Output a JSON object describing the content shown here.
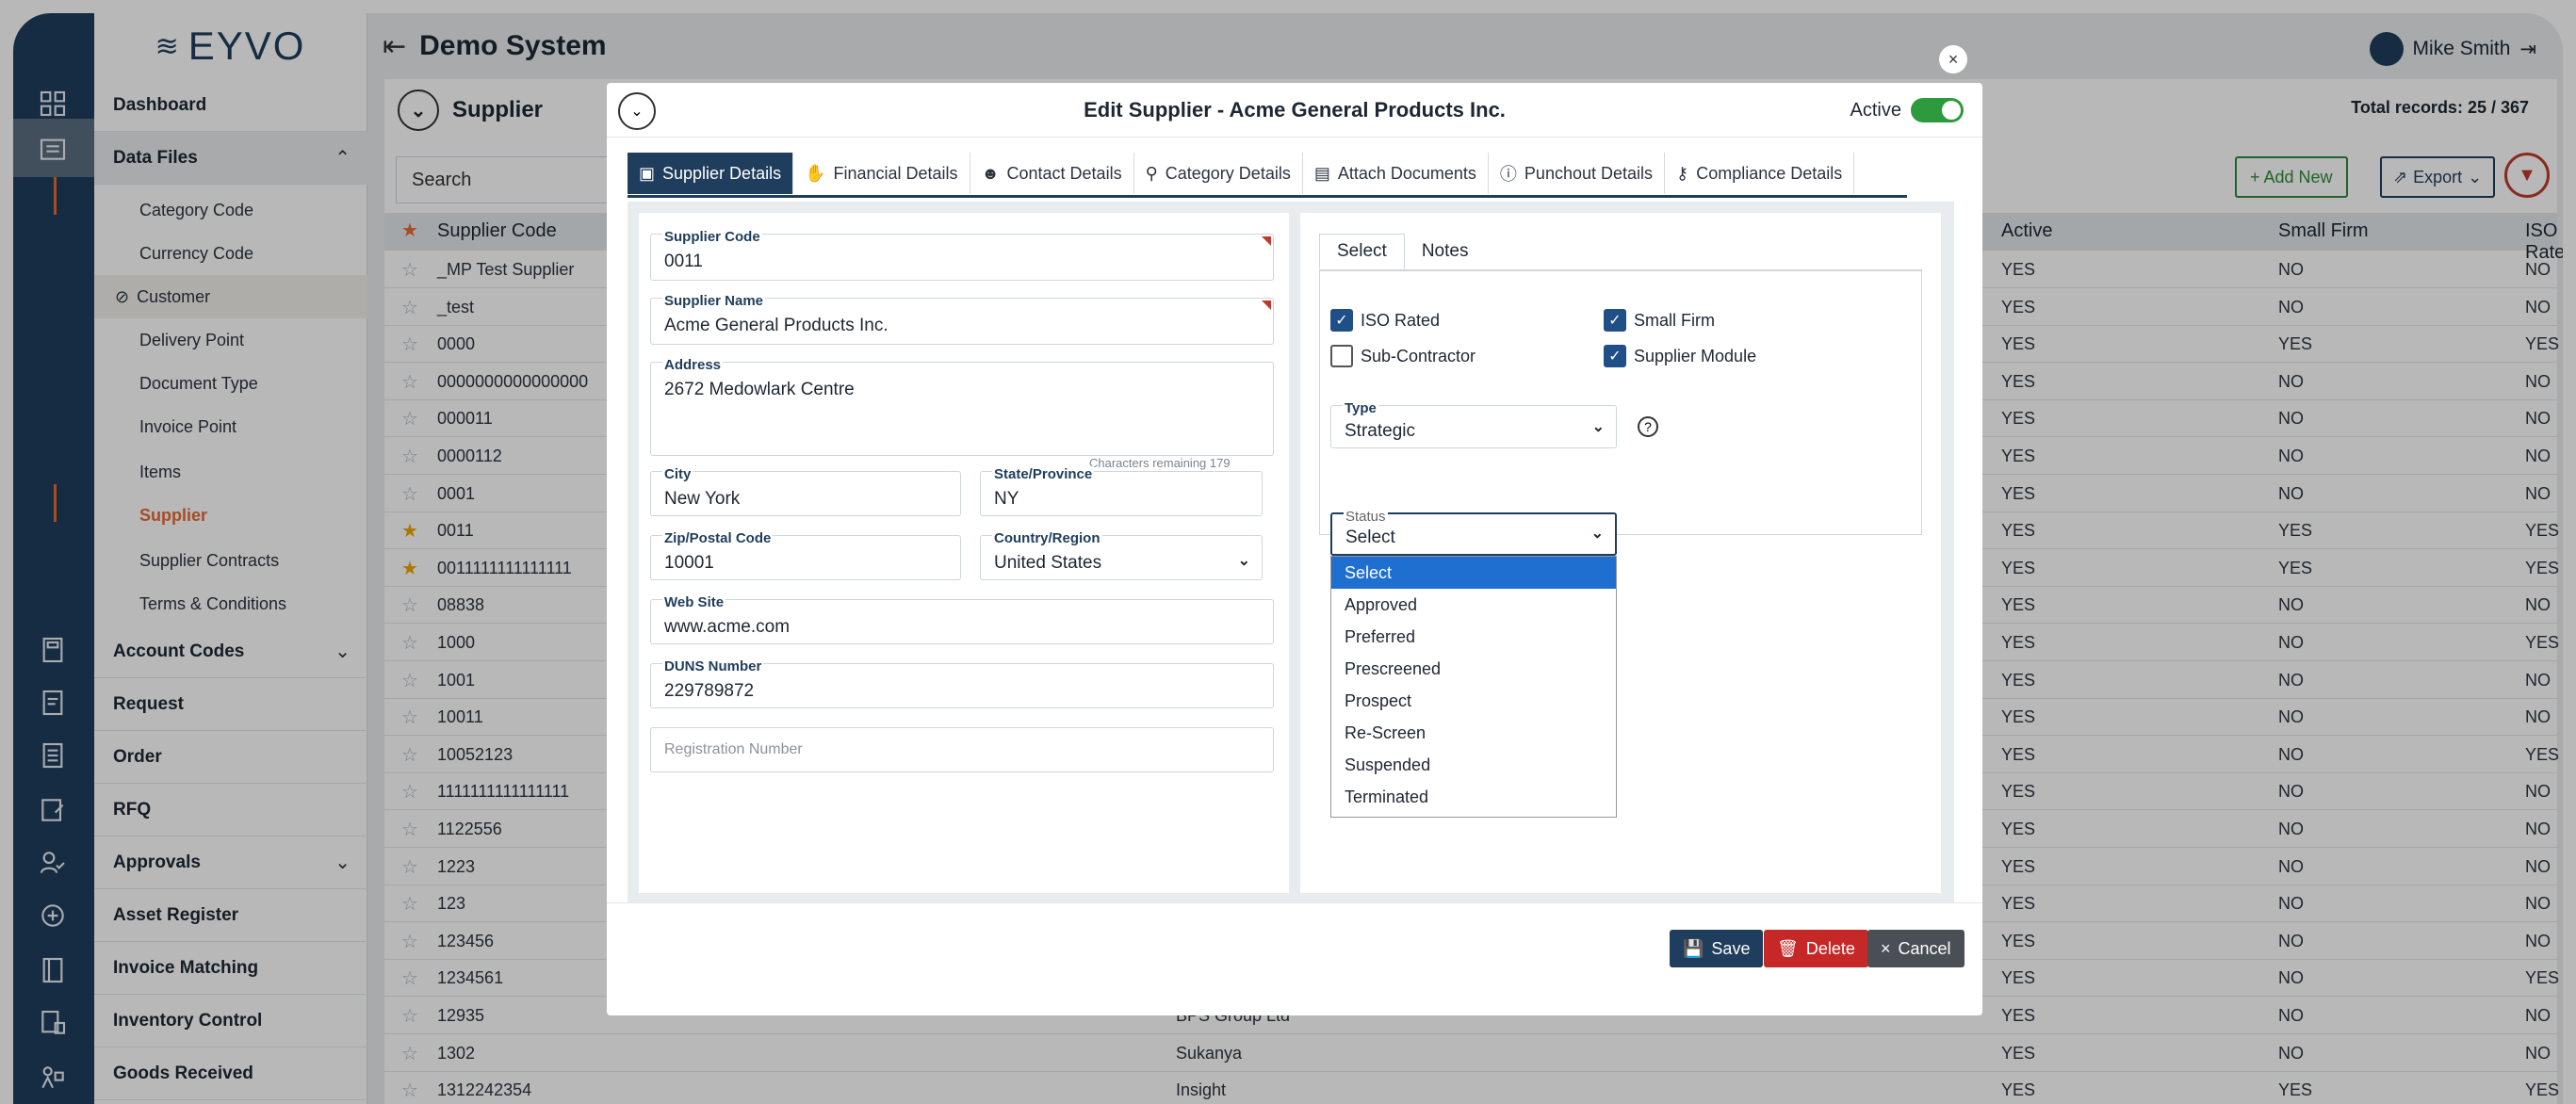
{
  "app": {
    "logo_text": "EYVO",
    "title": "Demo System",
    "user_name": "Mike Smith"
  },
  "sidebar": {
    "items": [
      {
        "label": "Dashboard"
      },
      {
        "label": "Data Files"
      },
      {
        "label": "Account Codes"
      },
      {
        "label": "Request"
      },
      {
        "label": "Order"
      },
      {
        "label": "RFQ"
      },
      {
        "label": "Approvals"
      },
      {
        "label": "Asset Register"
      },
      {
        "label": "Invoice Matching"
      },
      {
        "label": "Inventory Control"
      },
      {
        "label": "Goods Received"
      }
    ],
    "subitems": [
      {
        "label": "Category Code"
      },
      {
        "label": "Currency Code"
      },
      {
        "label": "Customer"
      },
      {
        "label": "Delivery Point"
      },
      {
        "label": "Document Type"
      },
      {
        "label": "Invoice Point"
      },
      {
        "label": "Items"
      },
      {
        "label": "Supplier"
      },
      {
        "label": "Supplier Contracts"
      },
      {
        "label": "Terms & Conditions"
      }
    ]
  },
  "list": {
    "title": "Supplier",
    "total_records": "Total records: 25 / 367",
    "search_placeholder": "Search",
    "add_new": "+ Add New",
    "export": "Export",
    "columns": {
      "code": "Supplier Code",
      "active": "Active",
      "small": "Small Firm",
      "iso": "ISO Rated"
    },
    "rows": [
      {
        "code": "_MP Test Supplier",
        "name": "",
        "active": "YES",
        "small": "NO",
        "iso": "NO",
        "star": false
      },
      {
        "code": "_test",
        "name": "",
        "active": "YES",
        "small": "NO",
        "iso": "NO",
        "star": false
      },
      {
        "code": "0000",
        "name": "",
        "active": "YES",
        "small": "YES",
        "iso": "YES",
        "star": false
      },
      {
        "code": "0000000000000000",
        "name": "",
        "active": "YES",
        "small": "NO",
        "iso": "NO",
        "star": false
      },
      {
        "code": "000011",
        "name": "",
        "active": "YES",
        "small": "NO",
        "iso": "NO",
        "star": false
      },
      {
        "code": "0000112",
        "name": "",
        "active": "YES",
        "small": "NO",
        "iso": "NO",
        "star": false
      },
      {
        "code": "0001",
        "name": "",
        "active": "YES",
        "small": "NO",
        "iso": "NO",
        "star": false
      },
      {
        "code": "0011",
        "name": "",
        "active": "YES",
        "small": "YES",
        "iso": "YES",
        "star": true
      },
      {
        "code": "0011111111111111",
        "name": "",
        "active": "YES",
        "small": "YES",
        "iso": "YES",
        "star": true
      },
      {
        "code": "08838",
        "name": "",
        "active": "YES",
        "small": "NO",
        "iso": "NO",
        "star": false
      },
      {
        "code": "1000",
        "name": "",
        "active": "YES",
        "small": "NO",
        "iso": "YES",
        "star": false
      },
      {
        "code": "1001",
        "name": "",
        "active": "YES",
        "small": "NO",
        "iso": "NO",
        "star": false
      },
      {
        "code": "10011",
        "name": "",
        "active": "YES",
        "small": "NO",
        "iso": "NO",
        "star": false
      },
      {
        "code": "10052123",
        "name": "",
        "active": "YES",
        "small": "NO",
        "iso": "YES",
        "star": false
      },
      {
        "code": "1111111111111111",
        "name": "",
        "active": "YES",
        "small": "NO",
        "iso": "NO",
        "star": false
      },
      {
        "code": "1122556",
        "name": "",
        "active": "YES",
        "small": "NO",
        "iso": "NO",
        "star": false
      },
      {
        "code": "1223",
        "name": "",
        "active": "YES",
        "small": "NO",
        "iso": "NO",
        "star": false
      },
      {
        "code": "123",
        "name": "",
        "active": "YES",
        "small": "NO",
        "iso": "NO",
        "star": false
      },
      {
        "code": "123456",
        "name": "",
        "active": "YES",
        "small": "NO",
        "iso": "NO",
        "star": false
      },
      {
        "code": "1234561",
        "name": "",
        "active": "YES",
        "small": "NO",
        "iso": "YES",
        "star": false
      },
      {
        "code": "12935",
        "name": "BPS Group Ltd",
        "active": "YES",
        "small": "NO",
        "iso": "NO",
        "star": false
      },
      {
        "code": "1302",
        "name": "Sukanya",
        "active": "YES",
        "small": "NO",
        "iso": "NO",
        "star": false
      },
      {
        "code": "1312242354",
        "name": "Insight",
        "active": "YES",
        "small": "YES",
        "iso": "YES",
        "star": false
      }
    ]
  },
  "modal": {
    "title": "Edit Supplier - Acme General Products Inc.",
    "active_label": "Active",
    "tabs": [
      {
        "label": "Supplier Details",
        "icon": "id-card-icon"
      },
      {
        "label": "Financial Details",
        "icon": "money-hand-icon"
      },
      {
        "label": "Contact Details",
        "icon": "people-icon"
      },
      {
        "label": "Category Details",
        "icon": "pin-icon"
      },
      {
        "label": "Attach Documents",
        "icon": "document-icon"
      },
      {
        "label": "Punchout Details",
        "icon": "info-icon"
      },
      {
        "label": "Compliance Details",
        "icon": "key-icon"
      }
    ],
    "fields": {
      "supplier_code": {
        "label": "Supplier Code",
        "value": "0011"
      },
      "supplier_name": {
        "label": "Supplier Name",
        "value": "Acme General Products Inc."
      },
      "address": {
        "label": "Address",
        "value": "2672 Medowlark Centre"
      },
      "chars_remaining": "Characters remaining 179",
      "city": {
        "label": "City",
        "value": "New York"
      },
      "state": {
        "label": "State/Province",
        "value": "NY"
      },
      "zip": {
        "label": "Zip/Postal Code",
        "value": "10001"
      },
      "country": {
        "label": "Country/Region",
        "value": "United States"
      },
      "website": {
        "label": "Web Site",
        "value": "www.acme.com"
      },
      "duns": {
        "label": "DUNS Number",
        "value": "229789872"
      },
      "registration_placeholder": "Registration Number"
    },
    "subtabs": [
      "Select",
      "Notes"
    ],
    "checkboxes": [
      {
        "label": "ISO Rated",
        "checked": true
      },
      {
        "label": "Small Firm",
        "checked": true
      },
      {
        "label": "Sub-Contractor",
        "checked": false
      },
      {
        "label": "Supplier Module",
        "checked": true
      }
    ],
    "type": {
      "label": "Type",
      "value": "Strategic"
    },
    "status": {
      "label": "Status",
      "value": "Select",
      "options": [
        "Select",
        "Approved",
        "Preferred",
        "Prescreened",
        "Prospect",
        "Re-Screen",
        "Suspended",
        "Terminated"
      ]
    },
    "buttons": {
      "save": "Save",
      "delete": "Delete",
      "cancel": "Cancel"
    }
  },
  "colors": {
    "navy": "#1f3d5c",
    "accent_orange": "#e86a32",
    "active_green": "#2e9a3e",
    "delete_red": "#c62828",
    "selected_option": "#1f6fd1"
  }
}
